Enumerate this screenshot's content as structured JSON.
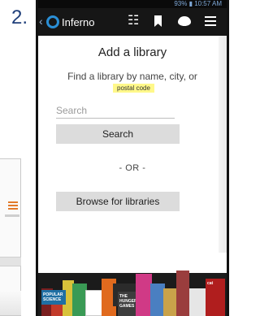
{
  "step": {
    "number": "2."
  },
  "statusbar": {
    "text": "93% ▮ 10:57 AM"
  },
  "appbar": {
    "title": "Inferno",
    "icons": [
      "back-icon",
      "app-logo-icon",
      "filter-icon",
      "bookmark-icon",
      "chat-icon",
      "menu-icon"
    ]
  },
  "main": {
    "heading": "Add a library",
    "instructions": "Find a library by name, city, or",
    "postal_hint": "postal code",
    "search_placeholder": "Search",
    "search_button": "Search",
    "or_text": "- OR -",
    "browse_button": "Browse for libraries"
  },
  "books": {
    "titles": [
      "POPULAR SCIENCE",
      "THE HUNGER GAMES",
      "cat"
    ]
  },
  "colors": {
    "appbar": "#161616",
    "logo": "#2a8fd6",
    "button": "#dcdcdc",
    "postal_highlight": "#fff88a",
    "step_number": "#1f3f7a"
  }
}
